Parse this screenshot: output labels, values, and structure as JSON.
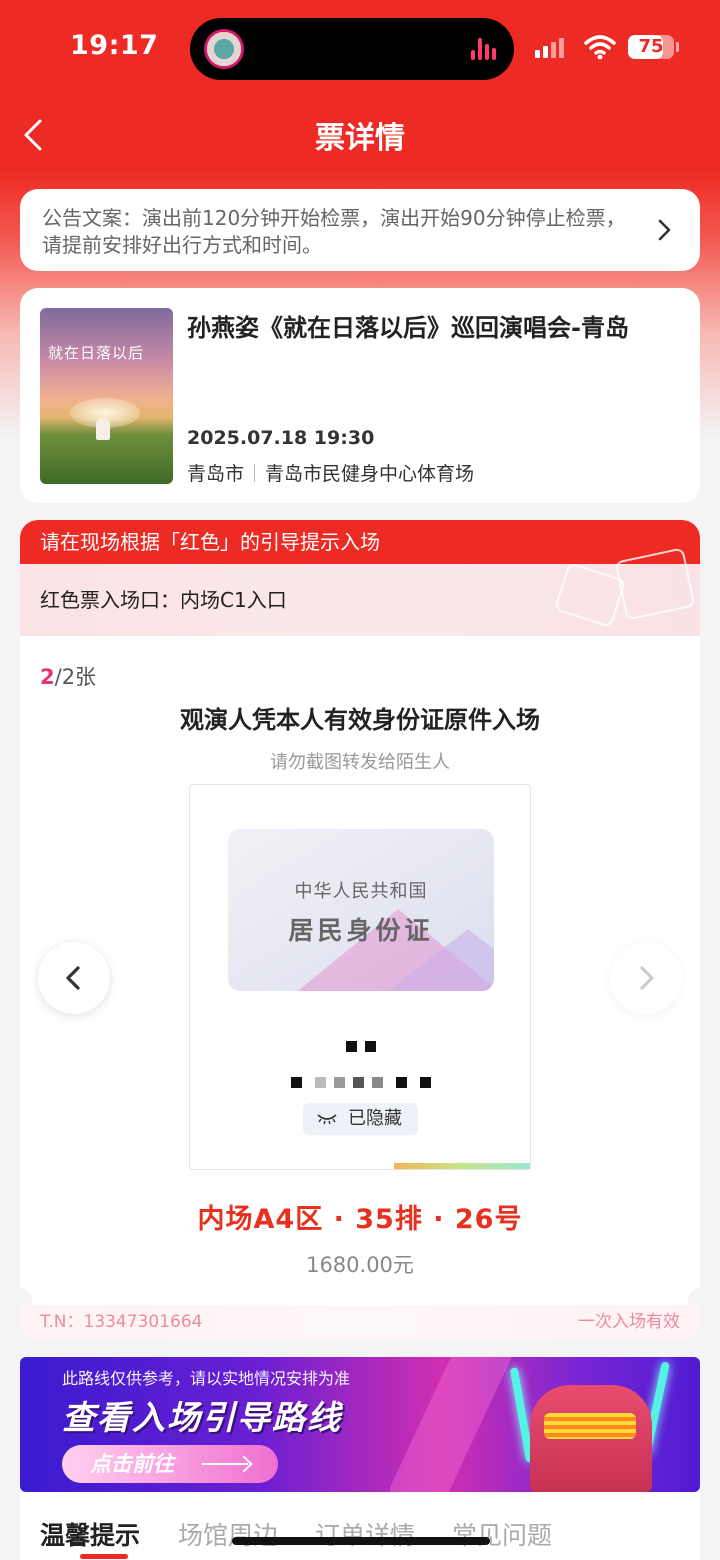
{
  "status_bar": {
    "time": "19:17",
    "battery": "75",
    "battery_level": 0.75
  },
  "nav": {
    "title": "票详情",
    "back_icon": "chevron-left-icon"
  },
  "notice": {
    "text": "公告文案：演出前120分钟开始检票，演出开始90分钟停止检票，请提前安排好出行方式和时间。",
    "chevron_icon": "chevron-right-icon"
  },
  "event": {
    "poster_title": "就在日落以后",
    "title": "孙燕姿《就在日落以后》巡回演唱会-青岛",
    "datetime": "2025.07.18 19:30",
    "city": "青岛市",
    "venue": "青岛市民健身中心体育场"
  },
  "ticket": {
    "entry_hint": "请在现场根据「红色」的引导提示入场",
    "gate": "红色票入场口：内场C1入口",
    "counter_current": "2",
    "counter_total": "/2张",
    "id_heading": "观演人凭本人有效身份证原件入场",
    "id_subheading": "请勿截图转发给陌生人",
    "id_card_line1": "中华人民共和国",
    "id_card_line2": "居民身份证",
    "hidden_label": "已隐藏",
    "hidden_icon": "eye-closed-icon",
    "seat": "内场A4区 · 35排 · 26号",
    "price": "1680.00元",
    "tn": "T.N：13347301664",
    "validity": "一次入场有效",
    "prev_icon": "chevron-left-icon",
    "next_icon": "chevron-right-icon"
  },
  "banner": {
    "note": "此路线仅供参考，请以实地情况安排为准",
    "headline": "查看入场引导路线",
    "cta": "点击前往"
  },
  "tabs": [
    {
      "label": "温馨提示",
      "active": true
    },
    {
      "label": "场馆周边",
      "active": false
    },
    {
      "label": "订单详情",
      "active": false
    },
    {
      "label": "常见问题",
      "active": false
    }
  ],
  "colors": {
    "brand_red": "#ee2a24",
    "counter_pink": "#e8356d",
    "seat_red": "#e8301f"
  }
}
